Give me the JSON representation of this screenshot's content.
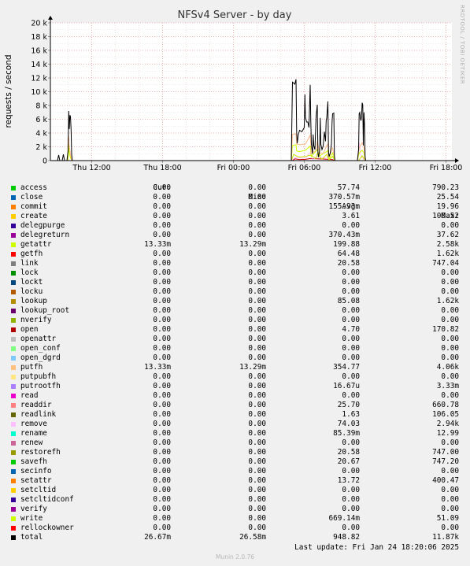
{
  "chart_data": {
    "type": "line",
    "title": "NFSv4 Server - by day",
    "ylabel": "requests / second",
    "yticks": [
      "0",
      "2 k",
      "4 k",
      "6 k",
      "8 k",
      "10 k",
      "12 k",
      "14 k",
      "16 k",
      "18 k",
      "20 k"
    ],
    "ylim": [
      0,
      20000
    ],
    "xlim_hours": [
      -3.5,
      30.5
    ],
    "xticks": [
      {
        "label": "Thu 12:00",
        "hour": 0
      },
      {
        "label": "Thu 18:00",
        "hour": 6
      },
      {
        "label": "Fri 00:00",
        "hour": 12
      },
      {
        "label": "Fri 06:00",
        "hour": 18
      },
      {
        "label": "Fri 12:00",
        "hour": 24
      },
      {
        "label": "Fri 18:00",
        "hour": 30
      }
    ],
    "grid": true,
    "series": [
      {
        "name": "total",
        "color": "#000000",
        "points": [
          [
            -2.9,
            0
          ],
          [
            -2.8,
            800
          ],
          [
            -2.7,
            0
          ],
          [
            -2.5,
            0
          ],
          [
            -2.4,
            900
          ],
          [
            -2.3,
            0
          ],
          [
            -2.1,
            0
          ],
          [
            -2.0,
            1400
          ],
          [
            -1.95,
            7200
          ],
          [
            -1.9,
            4600
          ],
          [
            -1.85,
            6600
          ],
          [
            -1.8,
            6400
          ],
          [
            -1.75,
            4500
          ],
          [
            -1.7,
            900
          ],
          [
            -1.65,
            0
          ],
          [
            16.9,
            0
          ],
          [
            17.0,
            11400
          ],
          [
            17.2,
            11100
          ],
          [
            17.3,
            11800
          ],
          [
            17.35,
            4300
          ],
          [
            17.4,
            2500
          ],
          [
            17.5,
            3800
          ],
          [
            17.6,
            4400
          ],
          [
            17.8,
            4200
          ],
          [
            18.0,
            4800
          ],
          [
            18.05,
            9600
          ],
          [
            18.1,
            6300
          ],
          [
            18.2,
            5600
          ],
          [
            18.3,
            5600
          ],
          [
            18.4,
            4800
          ],
          [
            18.5,
            11000
          ],
          [
            18.55,
            5600
          ],
          [
            18.6,
            2400
          ],
          [
            18.7,
            1000
          ],
          [
            18.75,
            3800
          ],
          [
            18.8,
            2200
          ],
          [
            18.9,
            1600
          ],
          [
            19.0,
            6400
          ],
          [
            19.1,
            8100
          ],
          [
            19.15,
            1200
          ],
          [
            19.2,
            500
          ],
          [
            19.3,
            1400
          ],
          [
            19.35,
            6200
          ],
          [
            19.4,
            2400
          ],
          [
            19.5,
            1600
          ],
          [
            19.6,
            2100
          ],
          [
            19.7,
            4200
          ],
          [
            19.8,
            2800
          ],
          [
            19.85,
            5800
          ],
          [
            19.9,
            6200
          ],
          [
            20.0,
            8600
          ],
          [
            20.05,
            1200
          ],
          [
            20.1,
            600
          ],
          [
            20.2,
            1100
          ],
          [
            20.3,
            2400
          ],
          [
            20.35,
            5600
          ],
          [
            20.4,
            6800
          ],
          [
            20.5,
            6900
          ],
          [
            20.55,
            600
          ],
          [
            20.6,
            0
          ],
          [
            22.5,
            0
          ],
          [
            22.6,
            1600
          ],
          [
            22.65,
            6800
          ],
          [
            22.7,
            7000
          ],
          [
            22.75,
            6200
          ],
          [
            22.8,
            5800
          ],
          [
            22.85,
            6400
          ],
          [
            22.9,
            8400
          ],
          [
            22.95,
            8100
          ],
          [
            23.0,
            2200
          ],
          [
            23.05,
            7000
          ],
          [
            23.1,
            5400
          ],
          [
            23.15,
            500
          ],
          [
            23.2,
            0
          ]
        ]
      },
      {
        "name": "putfh",
        "color": "#f8b88c",
        "points": [
          [
            -2.05,
            0
          ],
          [
            -2.0,
            3000
          ],
          [
            -1.95,
            3600
          ],
          [
            -1.9,
            2000
          ],
          [
            -1.8,
            1000
          ],
          [
            -1.7,
            0
          ],
          [
            16.9,
            0
          ],
          [
            17.0,
            3800
          ],
          [
            17.3,
            3900
          ],
          [
            17.35,
            2400
          ],
          [
            17.6,
            2300
          ],
          [
            18.1,
            2400
          ],
          [
            18.5,
            3700
          ],
          [
            18.6,
            1000
          ],
          [
            19.0,
            1500
          ],
          [
            19.1,
            2800
          ],
          [
            19.3,
            1100
          ],
          [
            19.6,
            1000
          ],
          [
            19.9,
            2200
          ],
          [
            20.0,
            2400
          ],
          [
            20.1,
            400
          ],
          [
            20.4,
            1900
          ],
          [
            20.55,
            300
          ],
          [
            20.6,
            0
          ],
          [
            22.5,
            0
          ],
          [
            22.65,
            1800
          ],
          [
            22.9,
            2600
          ],
          [
            23.05,
            2000
          ],
          [
            23.15,
            0
          ]
        ]
      },
      {
        "name": "getattr",
        "color": "#ccff00",
        "points": [
          [
            -2.0,
            0
          ],
          [
            -1.95,
            2400
          ],
          [
            -1.9,
            1200
          ],
          [
            -1.8,
            400
          ],
          [
            -1.7,
            0
          ],
          [
            16.9,
            0
          ],
          [
            17.0,
            2200
          ],
          [
            17.3,
            2300
          ],
          [
            17.35,
            1400
          ],
          [
            17.6,
            1300
          ],
          [
            18.1,
            1500
          ],
          [
            18.5,
            2100
          ],
          [
            18.6,
            600
          ],
          [
            19.1,
            1600
          ],
          [
            19.3,
            700
          ],
          [
            19.9,
            1300
          ],
          [
            20.0,
            1500
          ],
          [
            20.1,
            200
          ],
          [
            20.4,
            1100
          ],
          [
            20.55,
            100
          ],
          [
            20.6,
            0
          ],
          [
            22.5,
            0
          ],
          [
            22.65,
            1100
          ],
          [
            22.9,
            1500
          ],
          [
            23.05,
            1100
          ],
          [
            23.15,
            0
          ]
        ]
      },
      {
        "name": "write",
        "color": "#c8e000",
        "points": [
          [
            16.9,
            0
          ],
          [
            17.1,
            900
          ],
          [
            17.3,
            700
          ],
          [
            17.6,
            500
          ],
          [
            18.1,
            600
          ],
          [
            18.5,
            800
          ],
          [
            19.0,
            300
          ],
          [
            19.1,
            1000
          ],
          [
            19.5,
            200
          ],
          [
            19.9,
            900
          ],
          [
            20.1,
            100
          ],
          [
            20.4,
            600
          ],
          [
            20.6,
            0
          ],
          [
            22.6,
            0
          ],
          [
            22.9,
            700
          ],
          [
            23.1,
            200
          ],
          [
            23.15,
            0
          ]
        ]
      },
      {
        "name": "remove",
        "color": "#ffc0f0",
        "points": [
          [
            16.9,
            0
          ],
          [
            17.2,
            400
          ],
          [
            18.1,
            350
          ],
          [
            18.5,
            1200
          ],
          [
            18.7,
            100
          ],
          [
            19.1,
            600
          ],
          [
            19.9,
            300
          ],
          [
            20.0,
            1400
          ],
          [
            20.1,
            0
          ],
          [
            22.5,
            0
          ],
          [
            22.65,
            2600
          ],
          [
            22.8,
            500
          ],
          [
            23.0,
            300
          ],
          [
            23.1,
            0
          ]
        ]
      },
      {
        "name": "open",
        "color": "#cc0000",
        "points": [
          [
            17.0,
            0
          ],
          [
            17.2,
            250
          ],
          [
            17.6,
            150
          ],
          [
            18.1,
            180
          ],
          [
            18.5,
            300
          ],
          [
            19.1,
            250
          ],
          [
            19.9,
            200
          ],
          [
            20.4,
            150
          ],
          [
            20.6,
            0
          ]
        ]
      }
    ],
    "legend_columns": [
      "Cur:",
      "Min:",
      "Avg:",
      "Max:"
    ],
    "legend": [
      {
        "name": "access",
        "color": "#00cc00",
        "cur": "0.00",
        "min": "0.00",
        "avg": "57.74",
        "max": "790.23"
      },
      {
        "name": "close",
        "color": "#0066b3",
        "cur": "0.00",
        "min": "0.00",
        "avg": "370.57m",
        "max": "25.54"
      },
      {
        "name": "commit",
        "color": "#ff8000",
        "cur": "0.00",
        "min": "0.00",
        "avg": "155.93m",
        "max": "19.96"
      },
      {
        "name": "create",
        "color": "#ffcc00",
        "cur": "0.00",
        "min": "0.00",
        "avg": "3.61",
        "max": "100.52"
      },
      {
        "name": "delegpurge",
        "color": "#330099",
        "cur": "0.00",
        "min": "0.00",
        "avg": "0.00",
        "max": "0.00"
      },
      {
        "name": "delegreturn",
        "color": "#990099",
        "cur": "0.00",
        "min": "0.00",
        "avg": "370.43m",
        "max": "37.62"
      },
      {
        "name": "getattr",
        "color": "#ccff00",
        "cur": "13.33m",
        "min": "13.29m",
        "avg": "199.88",
        "max": "2.58k"
      },
      {
        "name": "getfh",
        "color": "#ff0000",
        "cur": "0.00",
        "min": "0.00",
        "avg": "64.48",
        "max": "1.62k"
      },
      {
        "name": "link",
        "color": "#808080",
        "cur": "0.00",
        "min": "0.00",
        "avg": "20.58",
        "max": "747.04"
      },
      {
        "name": "lock",
        "color": "#008f00",
        "cur": "0.00",
        "min": "0.00",
        "avg": "0.00",
        "max": "0.00"
      },
      {
        "name": "lockt",
        "color": "#00487d",
        "cur": "0.00",
        "min": "0.00",
        "avg": "0.00",
        "max": "0.00"
      },
      {
        "name": "locku",
        "color": "#b35a00",
        "cur": "0.00",
        "min": "0.00",
        "avg": "0.00",
        "max": "0.00"
      },
      {
        "name": "lookup",
        "color": "#b38f00",
        "cur": "0.00",
        "min": "0.00",
        "avg": "85.08",
        "max": "1.62k"
      },
      {
        "name": "lookup_root",
        "color": "#6b006b",
        "cur": "0.00",
        "min": "0.00",
        "avg": "0.00",
        "max": "0.00"
      },
      {
        "name": "nverify",
        "color": "#8fb300",
        "cur": "0.00",
        "min": "0.00",
        "avg": "0.00",
        "max": "0.00"
      },
      {
        "name": "open",
        "color": "#b30000",
        "cur": "0.00",
        "min": "0.00",
        "avg": "4.70",
        "max": "170.82"
      },
      {
        "name": "openattr",
        "color": "#bebebe",
        "cur": "0.00",
        "min": "0.00",
        "avg": "0.00",
        "max": "0.00"
      },
      {
        "name": "open_conf",
        "color": "#80ff80",
        "cur": "0.00",
        "min": "0.00",
        "avg": "0.00",
        "max": "0.00"
      },
      {
        "name": "open_dgrd",
        "color": "#80c9ff",
        "cur": "0.00",
        "min": "0.00",
        "avg": "0.00",
        "max": "0.00"
      },
      {
        "name": "putfh",
        "color": "#ffc080",
        "cur": "13.33m",
        "min": "13.29m",
        "avg": "354.77",
        "max": "4.06k"
      },
      {
        "name": "putpubfh",
        "color": "#ffe680",
        "cur": "0.00",
        "min": "0.00",
        "avg": "0.00",
        "max": "0.00"
      },
      {
        "name": "putrootfh",
        "color": "#aa80ff",
        "cur": "0.00",
        "min": "0.00",
        "avg": "16.67u",
        "max": "3.33m"
      },
      {
        "name": "read",
        "color": "#ee00cc",
        "cur": "0.00",
        "min": "0.00",
        "avg": "0.00",
        "max": "0.00"
      },
      {
        "name": "readdir",
        "color": "#ff8080",
        "cur": "0.00",
        "min": "0.00",
        "avg": "25.70",
        "max": "660.78"
      },
      {
        "name": "readlink",
        "color": "#666600",
        "cur": "0.00",
        "min": "0.00",
        "avg": "1.63",
        "max": "106.05"
      },
      {
        "name": "remove",
        "color": "#ffbfff",
        "cur": "0.00",
        "min": "0.00",
        "avg": "74.03",
        "max": "2.94k"
      },
      {
        "name": "rename",
        "color": "#00ffcc",
        "cur": "0.00",
        "min": "0.00",
        "avg": "85.39m",
        "max": "12.99"
      },
      {
        "name": "renew",
        "color": "#cc6699",
        "cur": "0.00",
        "min": "0.00",
        "avg": "0.00",
        "max": "0.00"
      },
      {
        "name": "restorefh",
        "color": "#999900",
        "cur": "0.00",
        "min": "0.00",
        "avg": "20.58",
        "max": "747.00"
      },
      {
        "name": "savefh",
        "color": "#00cc00",
        "cur": "0.00",
        "min": "0.00",
        "avg": "20.67",
        "max": "747.20"
      },
      {
        "name": "secinfo",
        "color": "#0066b3",
        "cur": "0.00",
        "min": "0.00",
        "avg": "0.00",
        "max": "0.00"
      },
      {
        "name": "setattr",
        "color": "#ff8000",
        "cur": "0.00",
        "min": "0.00",
        "avg": "13.72",
        "max": "400.47"
      },
      {
        "name": "setcltid",
        "color": "#ffcc00",
        "cur": "0.00",
        "min": "0.00",
        "avg": "0.00",
        "max": "0.00"
      },
      {
        "name": "setcltidconf",
        "color": "#330099",
        "cur": "0.00",
        "min": "0.00",
        "avg": "0.00",
        "max": "0.00"
      },
      {
        "name": "verify",
        "color": "#990099",
        "cur": "0.00",
        "min": "0.00",
        "avg": "0.00",
        "max": "0.00"
      },
      {
        "name": "write",
        "color": "#ccff00",
        "cur": "0.00",
        "min": "0.00",
        "avg": "669.14m",
        "max": "51.09"
      },
      {
        "name": "rellockowner",
        "color": "#ff0000",
        "cur": "0.00",
        "min": "0.00",
        "avg": "0.00",
        "max": "0.00"
      },
      {
        "name": "total",
        "color": "#000000",
        "cur": "26.67m",
        "min": "26.58m",
        "avg": "948.82",
        "max": "11.87k"
      }
    ]
  },
  "last_update": "Last update: Fri Jan 24 18:20:06 2025",
  "watermark": "RRDTOOL / TOBI OETIKER",
  "footer_version": "Munin 2.0.76"
}
